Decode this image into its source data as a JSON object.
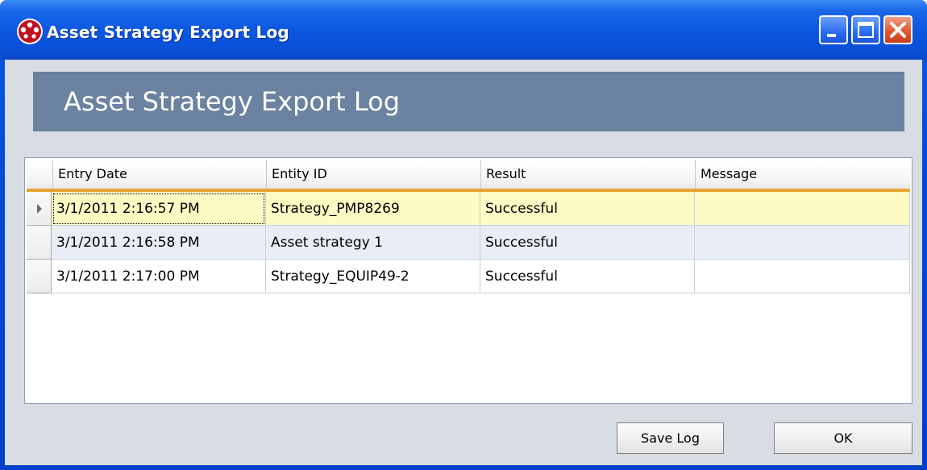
{
  "window": {
    "title": "Asset Strategy Export Log",
    "controls": {
      "minimize": "minimize-icon",
      "maximize": "maximize-icon",
      "close": "close-icon"
    }
  },
  "header": {
    "title": "Asset Strategy Export Log"
  },
  "table": {
    "columns": [
      "Entry Date",
      "Entity ID",
      "Result",
      "Message"
    ],
    "rows": [
      {
        "entry_date": "3/1/2011 2:16:57 PM",
        "entity_id": "Strategy_PMP8269",
        "result": "Successful",
        "message": ""
      },
      {
        "entry_date": "3/1/2011 2:16:58 PM",
        "entity_id": "Asset strategy 1",
        "result": "Successful",
        "message": ""
      },
      {
        "entry_date": "3/1/2011 2:17:00 PM",
        "entity_id": "Strategy_EQUIP49-2",
        "result": "Successful",
        "message": ""
      }
    ],
    "selected_row": 0
  },
  "buttons": {
    "save_log": "Save Log",
    "ok": "OK"
  },
  "colors": {
    "titlebar": "#0a56df",
    "header_band": "#6b82a0",
    "selected_row": "#fdfbc3",
    "alt_row": "#e9eef6",
    "header_underline": "#e4a533"
  }
}
